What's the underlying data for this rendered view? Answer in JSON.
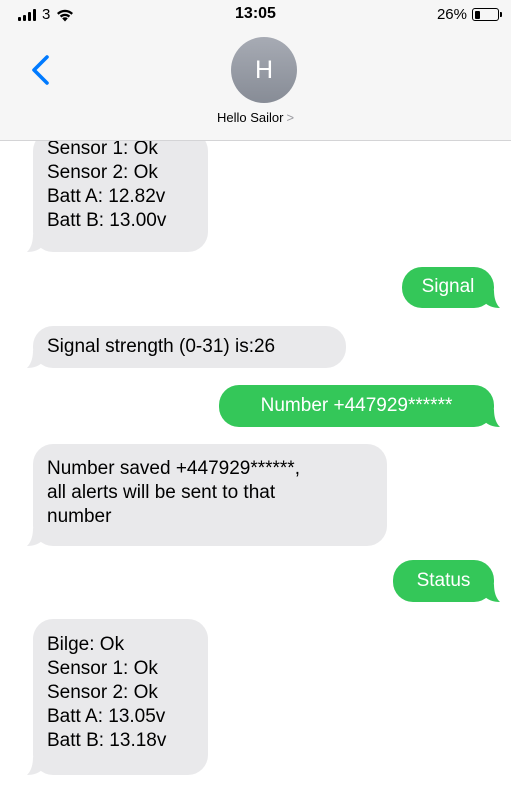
{
  "status_bar": {
    "carrier": "3",
    "time": "13:05",
    "battery_text": "26%",
    "battery_level": 0.26
  },
  "header": {
    "avatar_initial": "H",
    "contact_name": "Hello Sailor",
    "contact_chevron": ">"
  },
  "messages": [
    {
      "from": "received",
      "lines": [
        "Sensor 1: Ok",
        "Sensor 2: Ok",
        "Batt A: 12.82v",
        "Batt B: 13.00v"
      ]
    },
    {
      "from": "sent",
      "lines": [
        "Signal"
      ]
    },
    {
      "from": "received",
      "lines": [
        "Signal strength (0-31) is:26"
      ]
    },
    {
      "from": "sent",
      "lines": [
        "Number +447929******"
      ]
    },
    {
      "from": "received",
      "lines": [
        "Number saved +447929******,",
        "all alerts will be sent to that",
        "number"
      ]
    },
    {
      "from": "sent",
      "lines": [
        "Status"
      ]
    },
    {
      "from": "received",
      "lines": [
        "Bilge: Ok",
        "Sensor 1: Ok",
        "Sensor 2: Ok",
        "Batt A: 13.05v",
        "Batt B: 13.18v"
      ]
    }
  ],
  "colors": {
    "sent_bubble": "#34c759",
    "received_bubble": "#e9e9eb",
    "accent": "#007aff"
  }
}
